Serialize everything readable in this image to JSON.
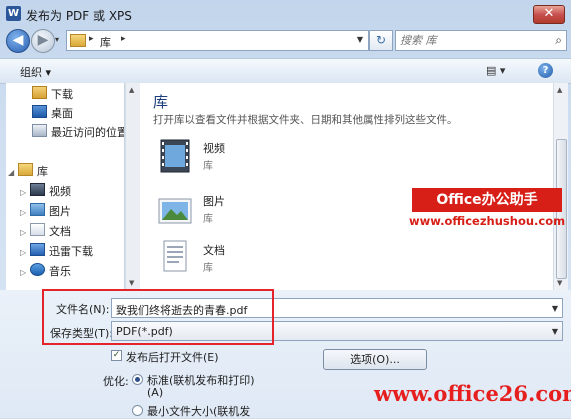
{
  "window": {
    "title": "发布为 PDF 或 XPS",
    "app_icon": "W",
    "close_glyph": "✕"
  },
  "nav": {
    "back_glyph": "◀",
    "forward_glyph": "▶",
    "history_glyph": "▾",
    "breadcrumb": "库",
    "crumb_sep": "▸",
    "address_dropdown_glyph": "▼",
    "refresh_glyph": "↻",
    "search_placeholder": "搜索 库",
    "search_glyph": "⌕"
  },
  "toolbar": {
    "organize_label": "组织 ▾",
    "view_label": "▤ ▾",
    "help_glyph": "?"
  },
  "sidebar": {
    "items": [
      {
        "label": "下载",
        "icon": "download-folder-icon"
      },
      {
        "label": "桌面",
        "icon": "desktop-icon"
      },
      {
        "label": "最近访问的位置",
        "icon": "recent-places-icon"
      },
      {
        "label": "库",
        "icon": "library-icon"
      },
      {
        "label": "视频",
        "icon": "video-library-icon"
      },
      {
        "label": "图片",
        "icon": "picture-library-icon"
      },
      {
        "label": "文档",
        "icon": "document-library-icon"
      },
      {
        "label": "迅雷下载",
        "icon": "thunder-download-icon"
      },
      {
        "label": "音乐",
        "icon": "music-library-icon"
      }
    ],
    "expand_glyph": "▷",
    "expanded_glyph": "◢"
  },
  "library": {
    "title": "库",
    "description": "打开库以查看文件并根据文件夹、日期和其他属性排列这些文件。",
    "items": [
      {
        "name": "视频",
        "type": "库"
      },
      {
        "name": "图片",
        "type": "库"
      },
      {
        "name": "文档",
        "type": "库"
      }
    ]
  },
  "form": {
    "filename_label": "文件名(N):",
    "filename_value": "致我们终将逝去的青春.pdf",
    "filetype_label": "保存类型(T):",
    "filetype_value": "PDF(*.pdf)",
    "dropdown_glyph": "▼",
    "open_after_publish_label": "发布后打开文件(E)",
    "open_after_publish_checked": "✓",
    "optimize_label": "优化:",
    "option_standard": "标准(联机发布和打印)",
    "option_standard_key": "(A)",
    "option_minimum": "最小文件大小(联机发",
    "options_button": "选项(O)..."
  },
  "watermark": {
    "badge": "Office办公助手",
    "url": "www.officezhushou.com",
    "bottom": "www.office26.com"
  },
  "colors": {
    "accent": "#1c3d7c",
    "highlight": "#e3242b",
    "watermark": "#d71f17"
  }
}
